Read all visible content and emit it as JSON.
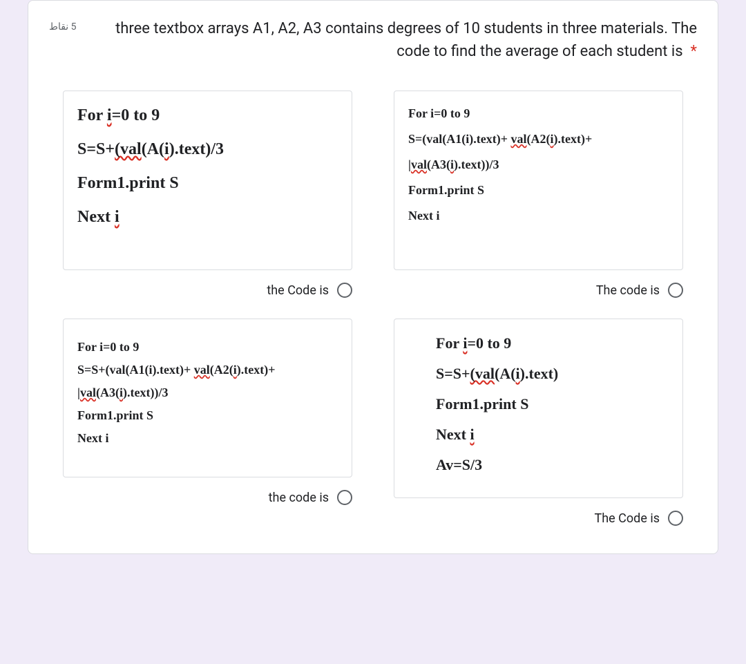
{
  "question": {
    "points": "5 نقاط",
    "text": "three textbox arrays A1, A2, A3 contains degrees of 10 students in three materials. The code to find the average of each student is"
  },
  "options": {
    "a": {
      "lines": [
        "For i=0 to 9",
        "S=S+(val(A(i).text)/3",
        "Form1.print S",
        "Next i"
      ],
      "label": "the Code is"
    },
    "b": {
      "lines": [
        "For i=0 to 9",
        "S=(val(A1(i).text)+ val(A2(i).text)+",
        "|val(A3(i).text))/3",
        "Form1.print S",
        "Next i"
      ],
      "label": "The code is"
    },
    "c": {
      "lines": [
        "For i=0 to 9",
        "S=S+(val(A1(i).text)+ val(A2(i).text)+",
        "|val(A3(i).text))/3",
        "Form1.print S",
        "Next i"
      ],
      "label": "the code is"
    },
    "d": {
      "lines": [
        "For i=0 to 9",
        "S=S+(val(A(i).text)",
        "Form1.print S",
        "Next i",
        "Av=S/3"
      ],
      "label": "The Code is"
    }
  }
}
